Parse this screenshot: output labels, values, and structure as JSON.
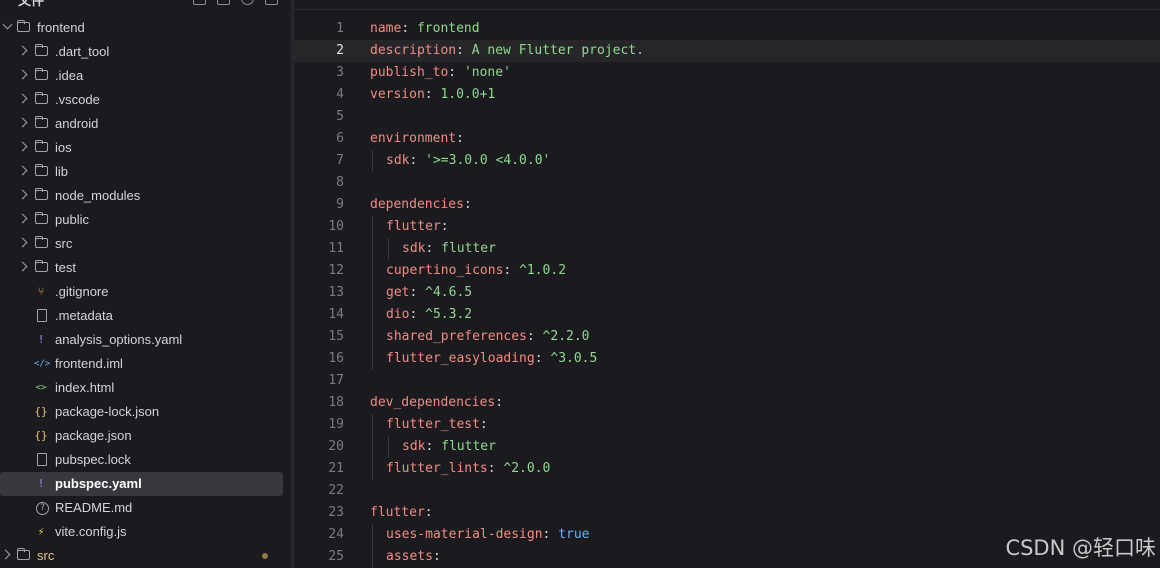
{
  "sidebar": {
    "title": "文件",
    "root": "frontend",
    "items": [
      {
        "label": ".dart_tool",
        "kind": "folder"
      },
      {
        "label": ".idea",
        "kind": "folder"
      },
      {
        "label": ".vscode",
        "kind": "folder"
      },
      {
        "label": "android",
        "kind": "folder"
      },
      {
        "label": "ios",
        "kind": "folder"
      },
      {
        "label": "lib",
        "kind": "folder"
      },
      {
        "label": "node_modules",
        "kind": "folder"
      },
      {
        "label": "public",
        "kind": "folder"
      },
      {
        "label": "src",
        "kind": "folder"
      },
      {
        "label": "test",
        "kind": "folder"
      },
      {
        "label": ".gitignore",
        "kind": "git"
      },
      {
        "label": ".metadata",
        "kind": "doc"
      },
      {
        "label": "analysis_options.yaml",
        "kind": "yaml"
      },
      {
        "label": "frontend.iml",
        "kind": "xml"
      },
      {
        "label": "index.html",
        "kind": "html"
      },
      {
        "label": "package-lock.json",
        "kind": "json"
      },
      {
        "label": "package.json",
        "kind": "json"
      },
      {
        "label": "pubspec.lock",
        "kind": "doc"
      },
      {
        "label": "pubspec.yaml",
        "kind": "yaml",
        "selected": true
      },
      {
        "label": "README.md",
        "kind": "info"
      },
      {
        "label": "vite.config.js",
        "kind": "vite"
      }
    ],
    "second_root": "src"
  },
  "icons": {
    "git": "⑂",
    "yaml": "!",
    "xml": "</>",
    "html": "<>",
    "json": "{}",
    "info": "?",
    "vite": "⚡"
  },
  "colors": {
    "key": "#f28b82",
    "string": "#8fd88f",
    "bool": "#5fb3f5",
    "selection": "#37373d"
  },
  "editor": {
    "current_line": 2,
    "lines": [
      {
        "n": "1",
        "indent": 0,
        "key": "name",
        "val": "frontend",
        "t": "s"
      },
      {
        "n": "2",
        "indent": 0,
        "key": "description",
        "val": "A new Flutter project.",
        "t": "s"
      },
      {
        "n": "3",
        "indent": 0,
        "key": "publish_to",
        "val": "'none'",
        "t": "s"
      },
      {
        "n": "4",
        "indent": 0,
        "key": "version",
        "val": "1.0.0+1",
        "t": "s"
      },
      {
        "n": "5",
        "indent": 0,
        "key": "",
        "val": "",
        "t": ""
      },
      {
        "n": "6",
        "indent": 0,
        "key": "environment",
        "val": "",
        "t": ""
      },
      {
        "n": "7",
        "indent": 1,
        "key": "sdk",
        "val": "'>=3.0.0 <4.0.0'",
        "t": "s"
      },
      {
        "n": "8",
        "indent": 0,
        "key": "",
        "val": "",
        "t": ""
      },
      {
        "n": "9",
        "indent": 0,
        "key": "dependencies",
        "val": "",
        "t": ""
      },
      {
        "n": "10",
        "indent": 1,
        "key": "flutter",
        "val": "",
        "t": ""
      },
      {
        "n": "11",
        "indent": 2,
        "key": "sdk",
        "val": "flutter",
        "t": "s"
      },
      {
        "n": "12",
        "indent": 1,
        "key": "cupertino_icons",
        "val": "^1.0.2",
        "t": "s"
      },
      {
        "n": "13",
        "indent": 1,
        "key": "get",
        "val": "^4.6.5",
        "t": "s"
      },
      {
        "n": "14",
        "indent": 1,
        "key": "dio",
        "val": "^5.3.2",
        "t": "s"
      },
      {
        "n": "15",
        "indent": 1,
        "key": "shared_preferences",
        "val": "^2.2.0",
        "t": "s"
      },
      {
        "n": "16",
        "indent": 1,
        "key": "flutter_easyloading",
        "val": "^3.0.5",
        "t": "s"
      },
      {
        "n": "17",
        "indent": 0,
        "key": "",
        "val": "",
        "t": ""
      },
      {
        "n": "18",
        "indent": 0,
        "key": "dev_dependencies",
        "val": "",
        "t": ""
      },
      {
        "n": "19",
        "indent": 1,
        "key": "flutter_test",
        "val": "",
        "t": ""
      },
      {
        "n": "20",
        "indent": 2,
        "key": "sdk",
        "val": "flutter",
        "t": "s"
      },
      {
        "n": "21",
        "indent": 1,
        "key": "flutter_lints",
        "val": "^2.0.0",
        "t": "s"
      },
      {
        "n": "22",
        "indent": 0,
        "key": "",
        "val": "",
        "t": ""
      },
      {
        "n": "23",
        "indent": 0,
        "key": "flutter",
        "val": "",
        "t": ""
      },
      {
        "n": "24",
        "indent": 1,
        "key": "uses-material-design",
        "val": "true",
        "t": "b"
      },
      {
        "n": "25",
        "indent": 1,
        "key": "assets",
        "val": "",
        "t": ""
      }
    ]
  },
  "watermark": "CSDN @轻口味"
}
